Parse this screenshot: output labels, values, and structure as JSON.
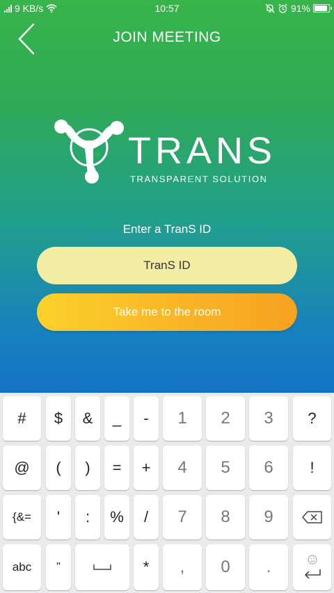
{
  "status_bar": {
    "network_speed": "9 KB/s",
    "time": "10:57",
    "battery": "91%",
    "battery_level": 0.91
  },
  "header": {
    "title": "JOIN MEETING"
  },
  "logo": {
    "wordmark": "TRANS",
    "tagline": "TRANSPARENT SOLUTION"
  },
  "form": {
    "prompt": "Enter a TranS ID",
    "id_placeholder": "TranS ID",
    "submit_label": "Take me to the room"
  },
  "colors": {
    "gradient_top": "#37b54a",
    "gradient_bottom": "#1373c7",
    "input_bg": "#f3eca3",
    "button_start": "#fbd12a",
    "button_end": "#f6a221"
  },
  "keyboard": {
    "row1": {
      "k1": "#",
      "k2": "$",
      "k3": "&",
      "k4": "_",
      "k5": "-",
      "n1": "1",
      "n2": "2",
      "n3": "3",
      "r": "?"
    },
    "row2": {
      "k1": "@",
      "k2": "(",
      "k3": ")",
      "k4": "=",
      "k5": "+",
      "n1": "4",
      "n2": "5",
      "n3": "6",
      "r": "!"
    },
    "row3": {
      "k1": "{&=",
      "k2": "'",
      "k3": ":",
      "k4": "%",
      "k5": "/",
      "n1": "7",
      "n2": "8",
      "n3": "9"
    },
    "row4": {
      "k1": "abc",
      "k2": "\"",
      "k4": "*",
      "n1": ",",
      "n2": "0",
      "n3": "."
    },
    "icons": {
      "backspace": "backspace-icon",
      "space": "space-icon",
      "enter": "enter-icon",
      "emoji": "emoji-icon"
    }
  }
}
